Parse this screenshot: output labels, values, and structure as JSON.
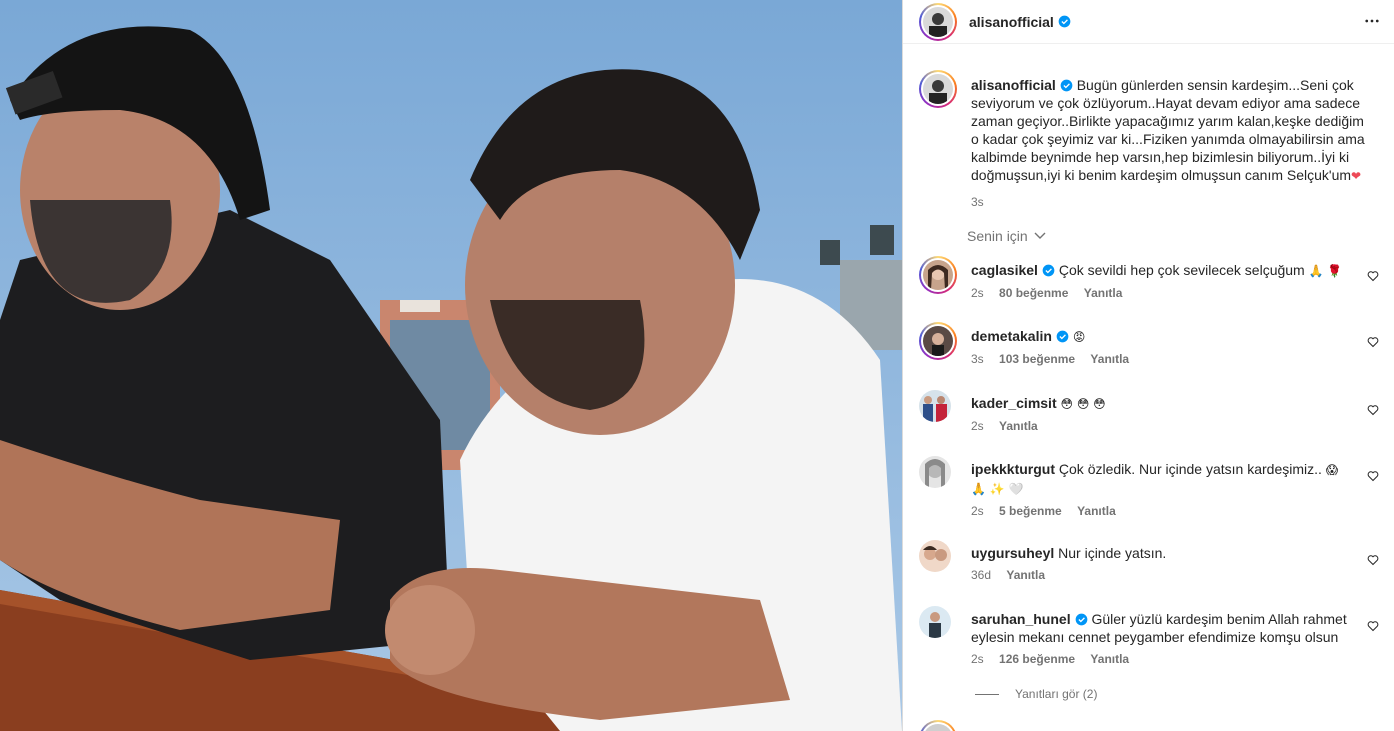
{
  "post": {
    "author": "alisanofficial",
    "caption": "Bugün günlerden sensin kardeşim...Seni çok seviyorum ve çok özlüyorum..Hayat devam ediyor ama sadece zaman geçiyor..Birlikte yapacağımız yarım kalan,keşke dediğim o kadar çok şeyimiz var ki...Fiziken yanımda olmayabilirsin ama kalbimde beynimde hep varsın,hep bizimlesin biliyorum..İyi ki doğmuşsun,iyi ki benim kardeşim olmuşsun canım Selçuk'um",
    "caption_emoji": "❤",
    "time": "3s"
  },
  "sort_label": "Senin için",
  "comments": [
    {
      "user": "caglasikel",
      "verified": true,
      "text": "Çok sevildi hep çok sevilecek selçuğum",
      "emoji": "🙏 🌹",
      "time": "2s",
      "likes": "80 beğenme",
      "reply": "Yanıtla"
    },
    {
      "user": "demetakalin",
      "verified": true,
      "text": "",
      "emoji": "😡",
      "time": "3s",
      "likes": "103 beğenme",
      "reply": "Yanıtla"
    },
    {
      "user": "kader_cimsit",
      "verified": false,
      "text": "",
      "emoji": "😳 😳 😳",
      "time": "2s",
      "likes": "",
      "reply": "Yanıtla"
    },
    {
      "user": "ipekkkturgut",
      "verified": false,
      "text": "Çok özledik. Nur içinde yatsın kardeşimiz..",
      "emoji": "😱 🙏 ✨ 🤍",
      "time": "2s",
      "likes": "5 beğenme",
      "reply": "Yanıtla"
    },
    {
      "user": "uygursuheyl",
      "verified": false,
      "text": "Nur içinde yatsın.",
      "emoji": "",
      "time": "36d",
      "likes": "",
      "reply": "Yanıtla"
    },
    {
      "user": "saruhan_hunel",
      "verified": true,
      "text": "Güler yüzlü kardeşim benim Allah rahmet eylesin mekanı cennet peygamber efendimize komşu olsun",
      "emoji": "",
      "time": "2s",
      "likes": "126 beğenme",
      "reply": "Yanıtla"
    }
  ],
  "view_replies": "Yanıtları gör (2)",
  "icons": {
    "verified": "verified-badge-icon",
    "more": "more-options-icon",
    "heart": "heart-icon",
    "chevron": "chevron-down-icon"
  },
  "colors": {
    "verified_blue": "#0095f6",
    "muted_text": "#737373",
    "heart_red": "#ed4956"
  }
}
